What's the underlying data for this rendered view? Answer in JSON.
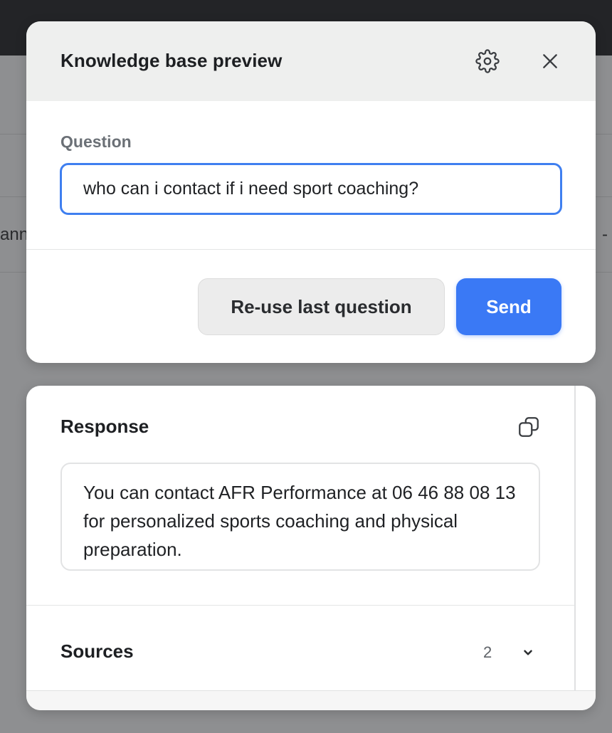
{
  "background": {
    "left_fragment": "ann",
    "right_fragment": "-"
  },
  "preview_modal": {
    "title": "Knowledge base preview",
    "question_label": "Question",
    "question_value": "who can i contact if i need sport coaching?",
    "reuse_label": "Re-use last question",
    "send_label": "Send",
    "icons": [
      "gear-icon",
      "close-icon"
    ]
  },
  "response_panel": {
    "title": "Response",
    "text": "You can contact AFR Performance at 06 46 88 08 13 for personalized sports coaching and physical preparation.",
    "sources_label": "Sources",
    "sources_count": "2",
    "icons": [
      "copy-icon",
      "chevron-down-icon"
    ]
  },
  "colors": {
    "accent": "#3a79f5",
    "focus_border": "#3f7ff0",
    "header_bg": "#eeefee",
    "overlay": "#8e8f91"
  }
}
